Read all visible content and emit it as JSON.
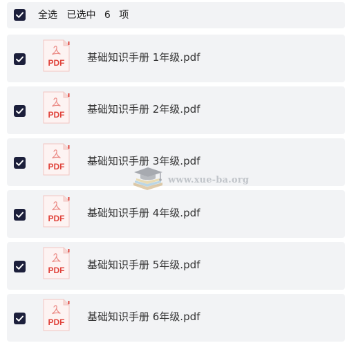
{
  "select_all": {
    "label": "全选",
    "selected_prefix": "已选中",
    "selected_count": "6",
    "selected_suffix": "项",
    "checked": true
  },
  "files": [
    {
      "name": "基础知识手册 1年级.pdf",
      "checked": true,
      "type_label": "PDF"
    },
    {
      "name": "基础知识手册 2年级.pdf",
      "checked": true,
      "type_label": "PDF"
    },
    {
      "name": "基础知识手册 3年级.pdf",
      "checked": true,
      "type_label": "PDF"
    },
    {
      "name": "基础知识手册 4年级.pdf",
      "checked": true,
      "type_label": "PDF"
    },
    {
      "name": "基础知识手册 5年级.pdf",
      "checked": true,
      "type_label": "PDF"
    },
    {
      "name": "基础知识手册 6年级.pdf",
      "checked": true,
      "type_label": "PDF"
    }
  ],
  "watermark": {
    "text": "www.xue-ba.org",
    "icon": "graduation-cap-book-icon"
  },
  "icons": {
    "checkbox": "checkmark-icon",
    "file": "pdf-file-icon"
  },
  "colors": {
    "checkbox_fill": "#1c1f3b",
    "row_background": "#f2f3f5",
    "pdf_red": "#e0433b",
    "text": "#333333"
  }
}
